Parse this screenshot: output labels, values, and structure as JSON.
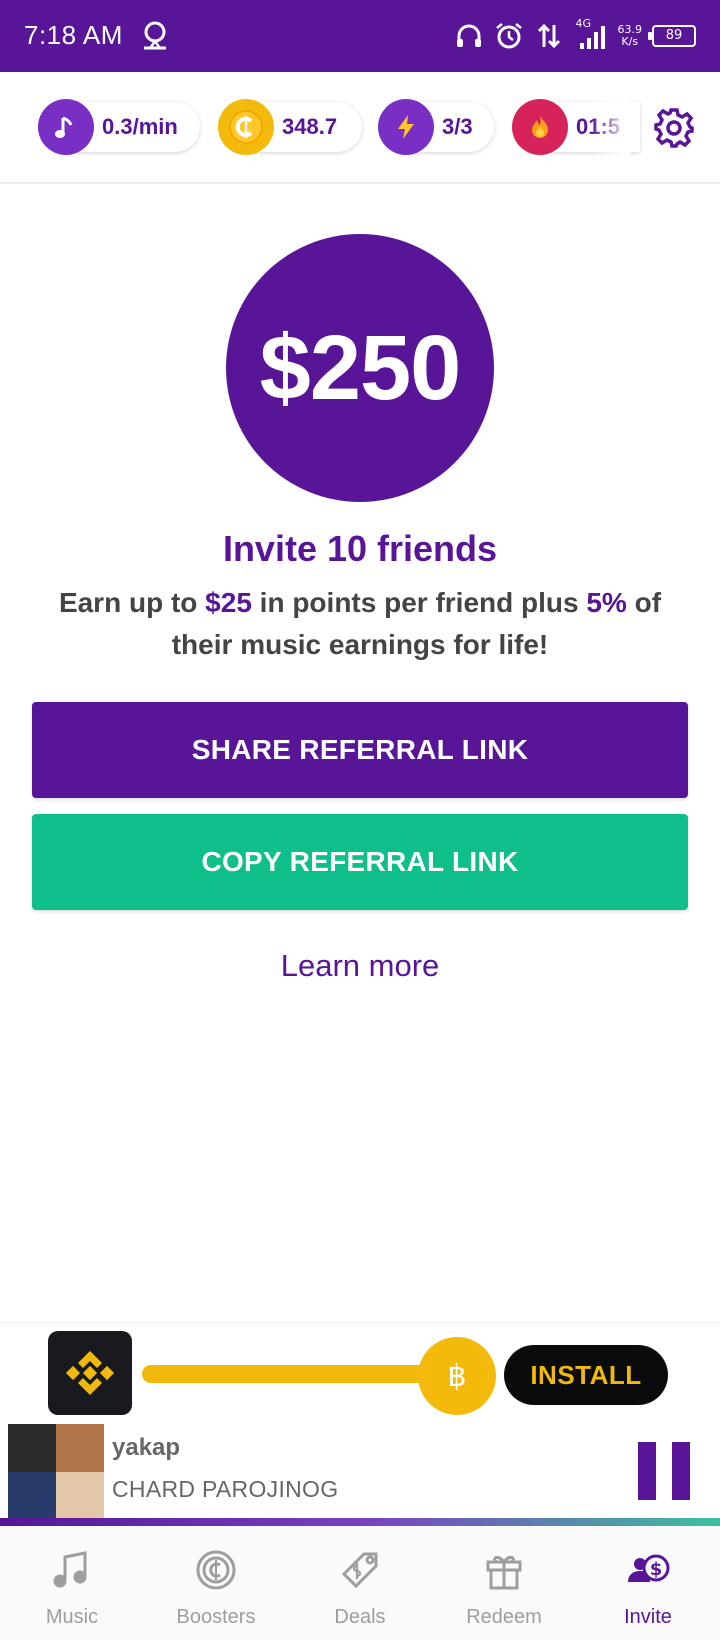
{
  "status_bar": {
    "time": "7:18 AM",
    "network": "4G",
    "speed_value": "63.9",
    "speed_unit": "K/s",
    "battery": "89"
  },
  "stats": {
    "rate": "0.3/min",
    "coins": "348.7",
    "boosts": "3/3",
    "timer": "01:5"
  },
  "hero": {
    "amount": "$250",
    "title": "Invite 10 friends",
    "desc_part1": "Earn up to ",
    "desc_highlight1": "$25",
    "desc_part2": " in points per friend plus ",
    "desc_highlight2": "5%",
    "desc_part3": " of their music earnings for life!"
  },
  "buttons": {
    "share": "SHARE REFERRAL LINK",
    "copy": "COPY REFERRAL LINK",
    "learn_more": "Learn more"
  },
  "ad": {
    "install": "INSTALL"
  },
  "player": {
    "song": "yakap",
    "artist": "CHARD PAROJINOG"
  },
  "nav": {
    "items": [
      {
        "label": "Music",
        "icon": "music-note-icon"
      },
      {
        "label": "Boosters",
        "icon": "coin-icon"
      },
      {
        "label": "Deals",
        "icon": "tag-icon"
      },
      {
        "label": "Redeem",
        "icon": "gift-icon"
      },
      {
        "label": "Invite",
        "icon": "invite-icon"
      }
    ],
    "active": "Invite"
  },
  "colors": {
    "brand_purple": "#581597",
    "accent_green": "#0ebf8b",
    "gold": "#f3ba0c",
    "fire_red": "#d6245a"
  }
}
